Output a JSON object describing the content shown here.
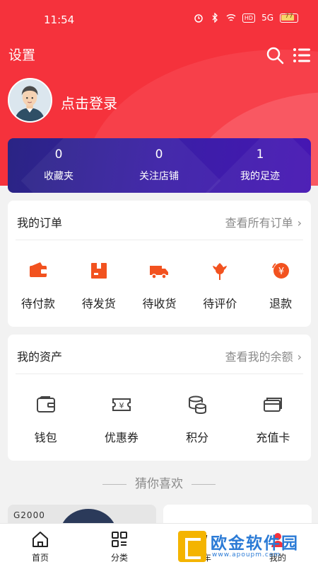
{
  "status_bar": {
    "time": "11:54",
    "signal": "5G",
    "battery": "77"
  },
  "header": {
    "settings_label": "设置"
  },
  "user": {
    "login_label": "点击登录"
  },
  "stats": [
    {
      "count": "0",
      "label": "收藏夹"
    },
    {
      "count": "0",
      "label": "关注店铺"
    },
    {
      "count": "1",
      "label": "我的足迹"
    }
  ],
  "orders": {
    "title": "我的订单",
    "link": "查看所有订单",
    "items": [
      {
        "label": "待付款",
        "icon": "wallet-icon"
      },
      {
        "label": "待发货",
        "icon": "package-icon"
      },
      {
        "label": "待收货",
        "icon": "truck-icon"
      },
      {
        "label": "待评价",
        "icon": "flower-icon"
      },
      {
        "label": "退款",
        "icon": "refund-icon"
      }
    ]
  },
  "assets": {
    "title": "我的资产",
    "link": "查看我的余额",
    "items": [
      {
        "label": "钱包",
        "icon": "wallet-outline-icon"
      },
      {
        "label": "优惠券",
        "icon": "coupon-icon"
      },
      {
        "label": "积分",
        "icon": "coins-icon"
      },
      {
        "label": "充值卡",
        "icon": "card-icon"
      }
    ]
  },
  "recommend": {
    "title": "猜你喜欢",
    "product1_brand": "G2000"
  },
  "tabbar": {
    "items": [
      {
        "label": "首页",
        "icon": "home-icon"
      },
      {
        "label": "分类",
        "icon": "category-icon"
      },
      {
        "label": "购物车",
        "icon": "cart-icon"
      },
      {
        "label": "我的",
        "icon": "user-icon"
      }
    ]
  },
  "watermark": {
    "text": "欧金软件园",
    "url": "www.apoupm.com"
  },
  "colors": {
    "primary": "#f5323c",
    "stats_bg": "#3a1fa6",
    "icon_orange": "#f2521f"
  }
}
